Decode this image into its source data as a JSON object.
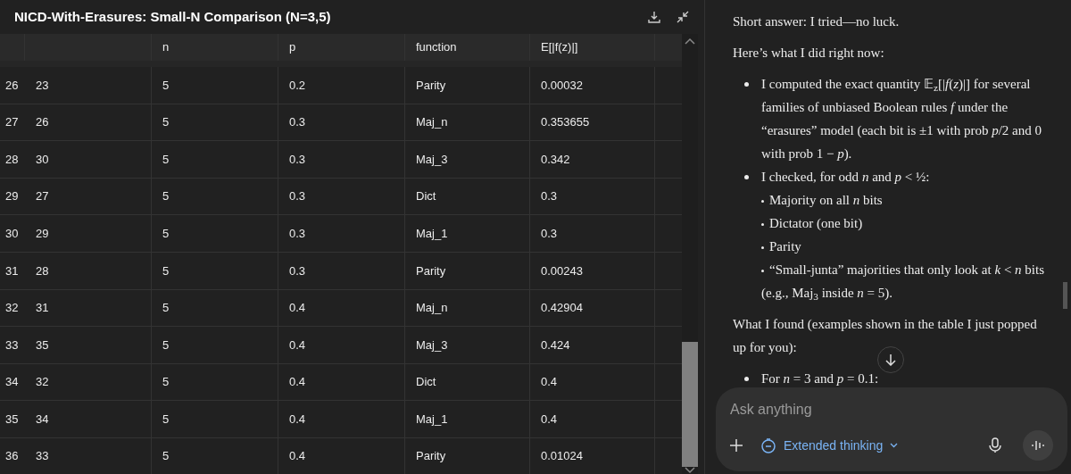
{
  "table_panel": {
    "title": "NICD-With-Erasures: Small-N Comparison (N=3,5)",
    "columns": [
      "",
      "n",
      "p",
      "function",
      "E[|f(z)|]"
    ],
    "rows": [
      {
        "index": "26",
        "cells": [
          "23",
          "5",
          "0.2",
          "Parity",
          "0.00032"
        ]
      },
      {
        "index": "27",
        "cells": [
          "26",
          "5",
          "0.3",
          "Maj_n",
          "0.353655"
        ]
      },
      {
        "index": "28",
        "cells": [
          "30",
          "5",
          "0.3",
          "Maj_3",
          "0.342"
        ]
      },
      {
        "index": "29",
        "cells": [
          "27",
          "5",
          "0.3",
          "Dict",
          "0.3"
        ]
      },
      {
        "index": "30",
        "cells": [
          "29",
          "5",
          "0.3",
          "Maj_1",
          "0.3"
        ]
      },
      {
        "index": "31",
        "cells": [
          "28",
          "5",
          "0.3",
          "Parity",
          "0.00243"
        ]
      },
      {
        "index": "32",
        "cells": [
          "31",
          "5",
          "0.4",
          "Maj_n",
          "0.42904"
        ]
      },
      {
        "index": "33",
        "cells": [
          "35",
          "5",
          "0.4",
          "Maj_3",
          "0.424"
        ]
      },
      {
        "index": "34",
        "cells": [
          "32",
          "5",
          "0.4",
          "Dict",
          "0.4"
        ]
      },
      {
        "index": "35",
        "cells": [
          "34",
          "5",
          "0.4",
          "Maj_1",
          "0.4"
        ]
      },
      {
        "index": "36",
        "cells": [
          "33",
          "5",
          "0.4",
          "Parity",
          "0.01024"
        ]
      }
    ]
  },
  "chat": {
    "blocks": [
      {
        "kind": "para",
        "text": "Short answer: I tried—no luck."
      },
      {
        "kind": "para",
        "text": "Here’s what I did right now:"
      },
      {
        "kind": "bullet",
        "text": "I computed the exact quantity 𝔼$_{z}$[|*f*(*z*)|] for several families of unbiased Boolean rules *f* under the “erasures” model (each bit is ±1 with prob *p*/2 and 0 with prob 1 − *p*)."
      },
      {
        "kind": "bullet",
        "text": "I checked, for odd *n* and *p* < ½:",
        "children": [
          "Majority on all *n* bits",
          "Dictator (one bit)",
          "Parity",
          "“Small-junta” majorities that only look at *k* < *n* bits (e.g., Maj$_{3}$ inside *n* = 5)."
        ]
      },
      {
        "kind": "para",
        "text": "What I found (examples shown in the table I just popped up for you):"
      },
      {
        "kind": "bullet",
        "text": "For *n* = 3 and *p* = 0.1:"
      }
    ],
    "composer": {
      "placeholder": "Ask anything",
      "mode": "Extended thinking"
    }
  }
}
